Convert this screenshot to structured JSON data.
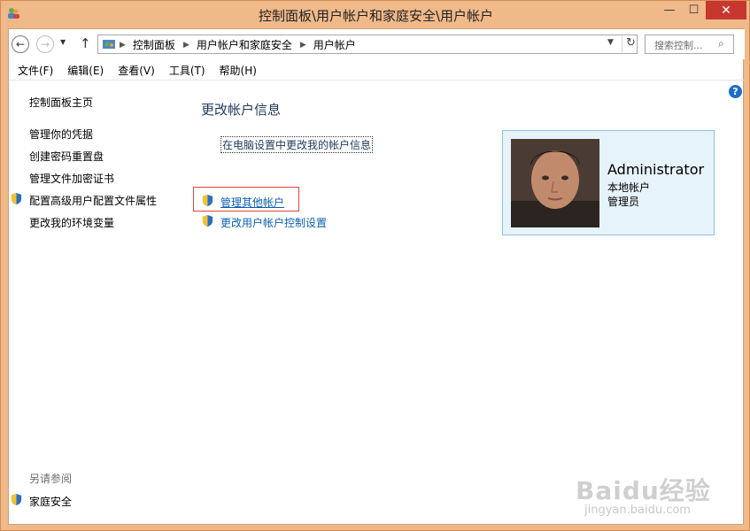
{
  "window": {
    "title": "控制面板\\用户帐户和家庭安全\\用户帐户",
    "minimize": "—",
    "maximize": "☐",
    "close": "✕"
  },
  "address": {
    "crumbs": [
      "控制面板",
      "用户帐户和家庭安全",
      "用户帐户"
    ],
    "search_placeholder": "搜索控制..."
  },
  "menu": [
    "文件(F)",
    "编辑(E)",
    "查看(V)",
    "工具(T)",
    "帮助(H)"
  ],
  "help_glyph": "?",
  "left_pane": {
    "home": "控制面板主页",
    "links": [
      "管理你的凭据",
      "创建密码重置盘",
      "管理文件加密证书",
      "配置高级用户配置文件属性",
      "更改我的环境变量"
    ],
    "see_also_title": "另请参阅",
    "see_also": [
      "家庭安全"
    ]
  },
  "main": {
    "heading": "更改帐户信息",
    "pc_settings_link": "在电脑设置中更改我的帐户信息",
    "manage_other": "管理其他帐户",
    "uac_settings": "更改用户帐户控制设置"
  },
  "account": {
    "name": "Administrator",
    "type": "本地帐户",
    "role": "管理员"
  },
  "watermark": {
    "logo": "Baidu经验",
    "url": "jingyan.baidu.com"
  },
  "colors": {
    "frame": "#f0b98a",
    "close": "#c7372f",
    "link": "#0b5fb3",
    "card_bg": "#e6f3fb",
    "highlight_box": "#e0453a"
  }
}
